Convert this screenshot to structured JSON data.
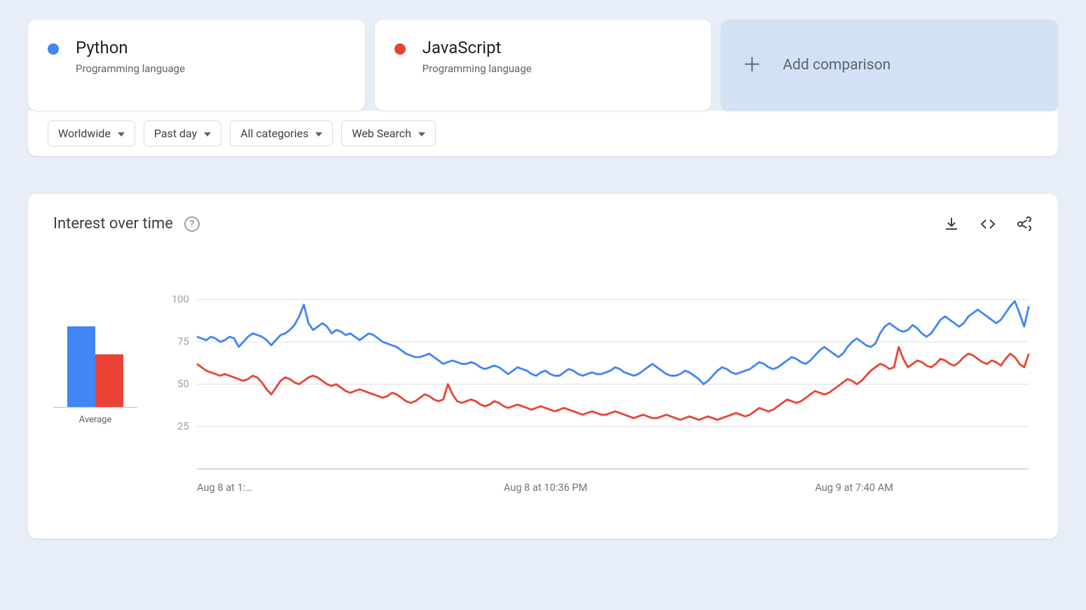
{
  "comparisons": [
    {
      "name": "Python",
      "subtitle": "Programming language",
      "color": "#4285f4"
    },
    {
      "name": "JavaScript",
      "subtitle": "Programming language",
      "color": "#ea4335"
    }
  ],
  "add_comparison_label": "Add comparison",
  "filters": {
    "region": "Worldwide",
    "time": "Past day",
    "category": "All categories",
    "type": "Web Search"
  },
  "panel": {
    "title": "Interest over time",
    "average_label": "Average"
  },
  "averages": [
    72,
    47
  ],
  "chart_data": {
    "type": "line",
    "title": "Interest over time",
    "ylabel": "",
    "xlabel": "",
    "ylim": [
      0,
      100
    ],
    "yticks": [
      25,
      50,
      75,
      100
    ],
    "x_labels": [
      "Aug 8 at 1:…",
      "Aug 8 at 10:36 PM",
      "Aug 9 at 7:40 AM"
    ],
    "categories_note": "Past-day, ~8-min samples; index 0..179",
    "series": [
      {
        "name": "Python",
        "color": "#4285f4",
        "values": [
          78,
          77,
          76,
          78,
          77,
          75,
          76,
          78,
          77,
          72,
          75,
          78,
          80,
          79,
          78,
          76,
          73,
          76,
          79,
          80,
          82,
          85,
          90,
          97,
          86,
          82,
          84,
          86,
          84,
          80,
          82,
          81,
          79,
          80,
          78,
          76,
          78,
          80,
          79,
          77,
          75,
          74,
          73,
          72,
          70,
          68,
          67,
          66,
          66,
          67,
          68,
          66,
          64,
          62,
          63,
          64,
          63,
          62,
          62,
          63,
          62,
          60,
          59,
          60,
          61,
          60,
          58,
          56,
          58,
          60,
          59,
          58,
          56,
          55,
          57,
          58,
          56,
          55,
          55,
          57,
          59,
          58,
          56,
          55,
          56,
          57,
          56,
          56,
          57,
          58,
          60,
          59,
          57,
          56,
          55,
          56,
          58,
          60,
          62,
          60,
          58,
          56,
          55,
          55,
          56,
          58,
          57,
          55,
          53,
          50,
          52,
          55,
          58,
          60,
          59,
          57,
          56,
          57,
          58,
          59,
          61,
          63,
          62,
          60,
          59,
          60,
          62,
          64,
          66,
          65,
          63,
          62,
          64,
          67,
          70,
          72,
          70,
          68,
          66,
          68,
          72,
          75,
          77,
          75,
          73,
          72,
          74,
          80,
          84,
          86,
          84,
          82,
          81,
          82,
          85,
          83,
          80,
          78,
          80,
          84,
          88,
          90,
          88,
          86,
          84,
          86,
          90,
          92,
          94,
          92,
          90,
          88,
          86,
          88,
          92,
          96,
          99,
          92,
          84,
          96
        ]
      },
      {
        "name": "JavaScript",
        "color": "#ea4335",
        "values": [
          62,
          60,
          58,
          57,
          56,
          55,
          56,
          55,
          54,
          53,
          52,
          53,
          55,
          54,
          51,
          47,
          44,
          48,
          52,
          54,
          53,
          51,
          50,
          52,
          54,
          55,
          54,
          52,
          50,
          49,
          50,
          48,
          46,
          45,
          46,
          47,
          46,
          45,
          44,
          43,
          42,
          43,
          45,
          44,
          42,
          40,
          39,
          40,
          42,
          44,
          43,
          41,
          40,
          41,
          50,
          44,
          40,
          39,
          40,
          41,
          40,
          38,
          37,
          38,
          40,
          39,
          37,
          36,
          37,
          38,
          37,
          36,
          35,
          36,
          37,
          36,
          35,
          34,
          35,
          36,
          35,
          34,
          33,
          32,
          33,
          34,
          33,
          32,
          32,
          33,
          34,
          33,
          32,
          31,
          30,
          31,
          32,
          31,
          30,
          30,
          31,
          32,
          31,
          30,
          29,
          30,
          31,
          30,
          29,
          30,
          31,
          30,
          29,
          30,
          31,
          32,
          33,
          32,
          31,
          32,
          34,
          36,
          35,
          34,
          35,
          37,
          39,
          41,
          40,
          39,
          40,
          42,
          44,
          46,
          45,
          44,
          45,
          47,
          49,
          51,
          53,
          52,
          50,
          52,
          55,
          58,
          60,
          62,
          61,
          59,
          60,
          72,
          65,
          60,
          62,
          64,
          63,
          61,
          60,
          62,
          65,
          64,
          62,
          61,
          63,
          66,
          68,
          67,
          65,
          63,
          62,
          64,
          63,
          61,
          65,
          68,
          66,
          62,
          60,
          68
        ]
      }
    ]
  }
}
